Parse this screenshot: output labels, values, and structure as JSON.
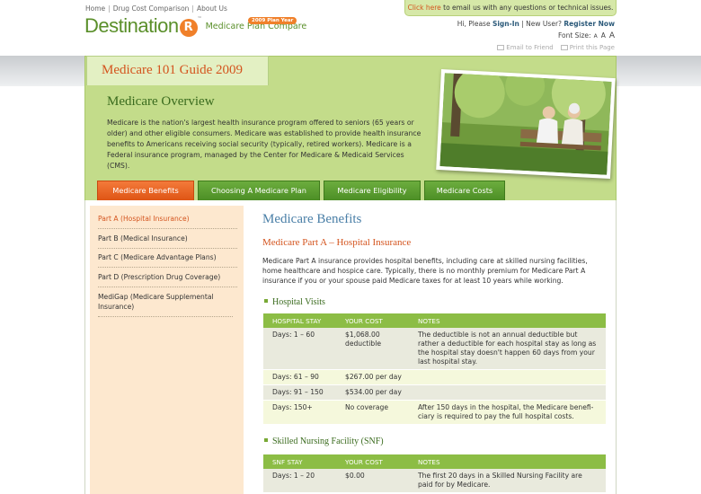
{
  "top_nav": {
    "home": "Home",
    "drug": "Drug Cost Comparison",
    "about": "About Us",
    "sep": "|"
  },
  "logo": {
    "text": "Destination",
    "rx": "R",
    "tm": "™",
    "tagline": "Medicare Plan Compare",
    "badge": "2009 Plan Year"
  },
  "email_bar": {
    "link": "Click here",
    "text": " to email us with any questions or technical issues."
  },
  "account": {
    "greeting": "Hi, Please ",
    "signin": "Sign-In",
    "sep": " | New User? ",
    "register": "Register Now"
  },
  "font_size": {
    "label": "Font Size:",
    "small": "A",
    "medium": "A",
    "large": "A"
  },
  "utility": {
    "email": "Email to Friend",
    "print": "Print this Page"
  },
  "hero": {
    "guide_title": "Medicare 101 Guide 2009",
    "heading": "Medicare Overview",
    "paragraph": "Medicare is the nation's largest health insurance program offered to seniors (65 years or older) and other eligible consumers.  Medicare was established to provide health insurance benefits to Americans receiving social security (typically, retired workers).  Medicare is a Federal insurance program, managed by the Center for Medicare & Medicaid Services (CMS)."
  },
  "tabs": [
    {
      "label": "Medicare Benefits"
    },
    {
      "label": "Choosing A Medicare Plan"
    },
    {
      "label": "Medicare Eligibility"
    },
    {
      "label": "Medicare Costs"
    }
  ],
  "sidebar": [
    {
      "label": "Part A (Hospital Insurance)"
    },
    {
      "label": "Part B (Medical Insurance)"
    },
    {
      "label": "Part C (Medicare Advantage Plans)"
    },
    {
      "label": "Part D (Prescription Drug Coverage)"
    },
    {
      "label": "MediGap (Medicare Supplemental Insurance)"
    }
  ],
  "main": {
    "title": "Medicare Benefits",
    "part_title": "Medicare Part A – Hospital Insurance",
    "part_para": "Medicare Part A insurance provides hospital benefits, including care at skilled nursing facilities, home healthcare and hospice care.  Typically, there is no monthly premium for Medicare Part A insurance if you or your spouse paid Medicare taxes for at least 10 years while working.",
    "hospital": {
      "title": "Hospital Visits",
      "headers": [
        "HOSPITAL STAY",
        "YOUR COST",
        "NOTES"
      ],
      "rows": [
        [
          "Days:  1 – 60",
          "$1,068.00 deductible",
          "The deductible is not an annual deductible but rather a deductible for each hospital stay as long as the hospital stay doesn't happen 60 days from your last hospital stay."
        ],
        [
          "Days:  61 – 90",
          "$267.00 per day",
          ""
        ],
        [
          "Days:  91 – 150",
          "$534.00 per day",
          ""
        ],
        [
          "Days:  150+",
          "No coverage",
          "After 150 days in the hospital, the Medicare benefi-ciary is required to pay the full hospital costs."
        ]
      ]
    },
    "snf": {
      "title": "Skilled Nursing Facility (SNF)",
      "headers": [
        "SNF STAY",
        "YOUR COST",
        "NOTES"
      ],
      "rows": [
        [
          "Days:  1 – 20",
          "$0.00",
          "The first 20 days in a Skilled Nursing Facility are paid for by Medicare."
        ]
      ]
    }
  }
}
